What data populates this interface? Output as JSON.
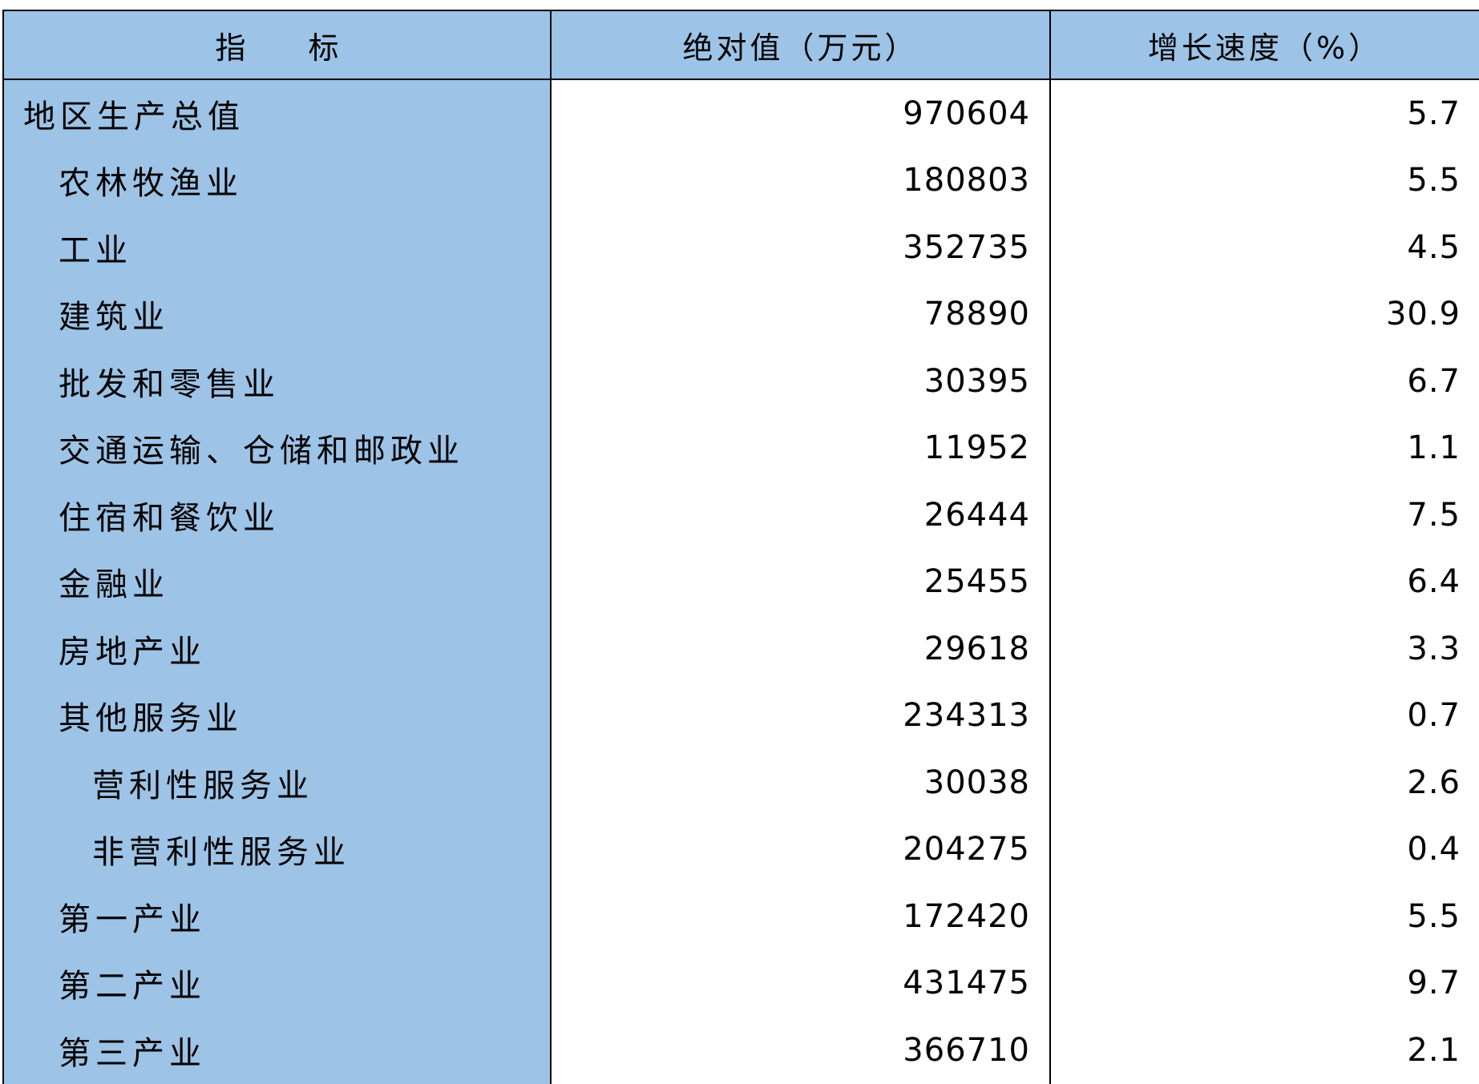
{
  "table": {
    "headers": {
      "indicator": [
        "指",
        "标"
      ],
      "absolute_value": "绝对值（万元）",
      "growth_rate": "增长速度（%）"
    },
    "rows": [
      {
        "name": "地区生产总值",
        "level": 0,
        "value": "970604",
        "growth": "5.7"
      },
      {
        "name": "农林牧渔业",
        "level": 1,
        "value": "180803",
        "growth": "5.5"
      },
      {
        "name": "工业",
        "level": 1,
        "value": "352735",
        "growth": "4.5"
      },
      {
        "name": "建筑业",
        "level": 1,
        "value": "78890",
        "growth": "30.9"
      },
      {
        "name": "批发和零售业",
        "level": 1,
        "value": "30395",
        "growth": "6.7"
      },
      {
        "name": "交通运输、仓储和邮政业",
        "level": 1,
        "value": "11952",
        "growth": "1.1"
      },
      {
        "name": "住宿和餐饮业",
        "level": 1,
        "value": "26444",
        "growth": "7.5"
      },
      {
        "name": "金融业",
        "level": 1,
        "value": "25455",
        "growth": "6.4"
      },
      {
        "name": "房地产业",
        "level": 1,
        "value": "29618",
        "growth": "3.3"
      },
      {
        "name": "其他服务业",
        "level": 1,
        "value": "234313",
        "growth": "0.7"
      },
      {
        "name": "营利性服务业",
        "level": 2,
        "value": "30038",
        "growth": "2.6"
      },
      {
        "name": "非营利性服务业",
        "level": 2,
        "value": "204275",
        "growth": "0.4"
      },
      {
        "name": "第一产业",
        "level": 1,
        "value": "172420",
        "growth": "5.5"
      },
      {
        "name": "第二产业",
        "level": 1,
        "value": "431475",
        "growth": "9.7"
      },
      {
        "name": "第三产业",
        "level": 1,
        "value": "366710",
        "growth": "2.1"
      }
    ]
  }
}
